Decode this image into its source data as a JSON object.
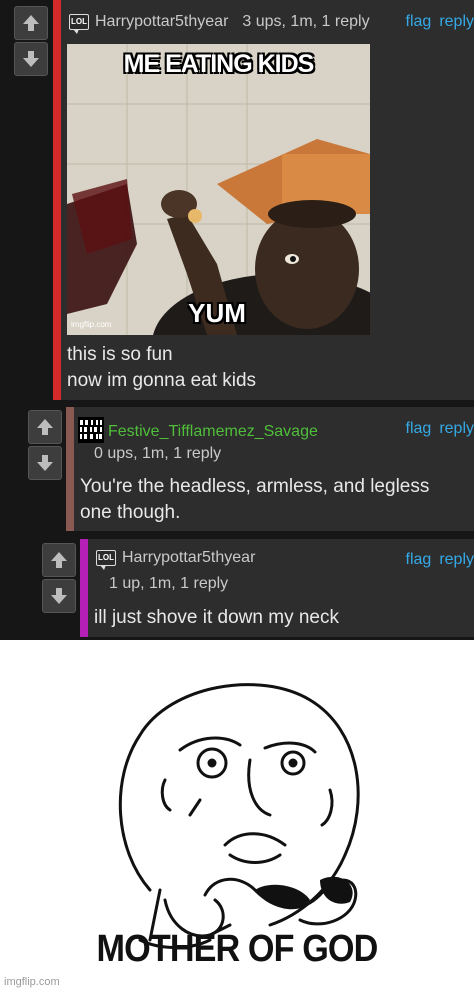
{
  "comments": [
    {
      "user": "Harrypottar5thyear",
      "badge": "LOL",
      "stats": "3 ups, 1m, 1 reply",
      "body_line1": "this is so fun",
      "body_line2": "now im gonna eat kids",
      "bar_color": "#d42a2a",
      "meme": {
        "top_text": "ME EATING KIDS",
        "bottom_text": "YUM",
        "watermark": "imgflip.com"
      }
    },
    {
      "user": "Festive_Tifflamemez_Savage",
      "stats": "0 ups, 1m, 1 reply",
      "body_line1": "You're the headless, armless, and legless",
      "body_line2": "one though.",
      "bar_color": "#8a5a52",
      "user_color": "#4fbf3a"
    },
    {
      "user": "Harrypottar5thyear",
      "badge": "LOL",
      "stats": "1 up, 1m, 1 reply",
      "body_line1": "ill just shove it down my neck",
      "bar_color": "#b51fb5"
    }
  ],
  "actions": {
    "flag": "flag",
    "reply": "reply"
  },
  "reaction_meme": {
    "caption": "MOTHER OF GOD",
    "watermark": "imgflip.com"
  },
  "colors": {
    "link": "#35a9e6",
    "background": "#161616",
    "panel": "#2d2d2d"
  }
}
